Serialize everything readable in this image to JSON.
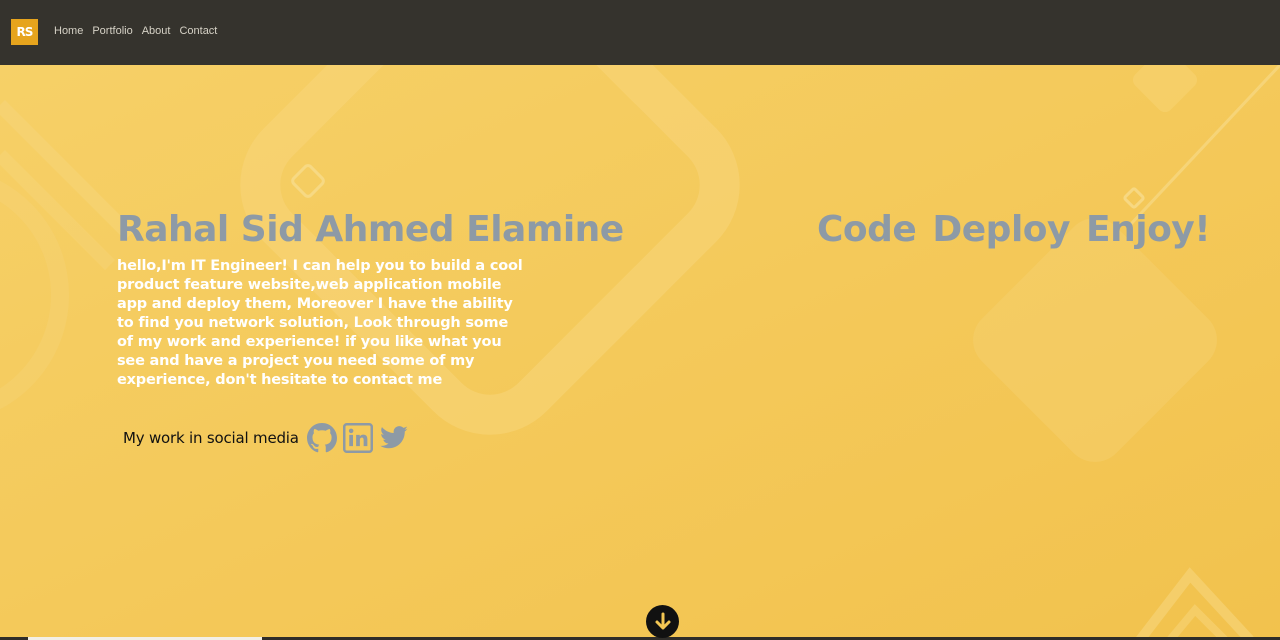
{
  "header": {
    "logo_text": "RS",
    "nav": [
      {
        "label": "Home"
      },
      {
        "label": "Portfolio"
      },
      {
        "label": "About"
      },
      {
        "label": "Contact"
      }
    ]
  },
  "hero": {
    "name": "Rahal Sid Ahmed Elamine",
    "tagline": "Code Deploy Enjoy!",
    "bio": "hello,I'm IT Engineer! I can help you to build a cool product feature website,web application mobile app and deploy them, Moreover I have the ability to find you network solution, Look through some of my work and experience! if you like what you see and have a project you need some of my experience, don't hesitate to contact me",
    "social_label": "My work in social media",
    "social_icons": [
      "github-icon",
      "linkedin-icon",
      "twitter-icon"
    ],
    "scroll_icon": "arrow-down-icon"
  },
  "colors": {
    "navbar": "#35332d",
    "background": "#f3c653",
    "accent": "#e6a41d",
    "heading": "#8d9aa6",
    "body_text": "#ffffff"
  }
}
